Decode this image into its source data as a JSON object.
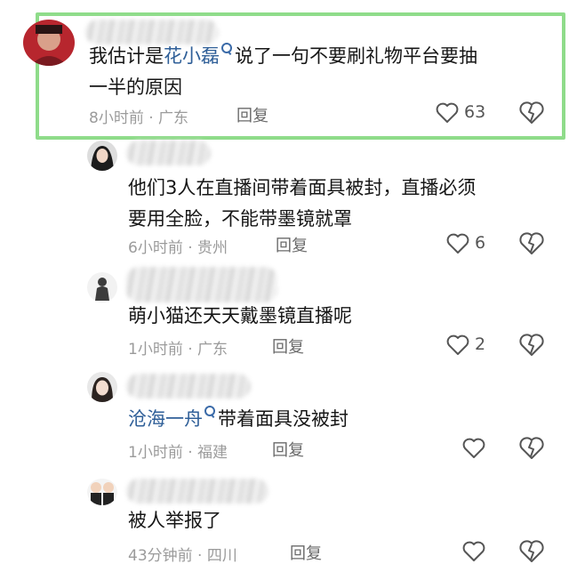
{
  "top_fragment": "••",
  "comments": [
    {
      "avatar": "red-avatar",
      "text_before": "我估计是",
      "mention": "花小磊",
      "text_after": "说了一句不要刷礼物平台要抽",
      "text_line2": "一半的原因",
      "time": "8小时前",
      "location": "广东",
      "reply_label": "回复",
      "like_count": "63",
      "highlighted": true
    },
    {
      "avatar": "woman-avatar",
      "text_line1": "他们3人在直播间带着面具被封，直播必须",
      "text_line2": "要用全脸，不能带墨镜就罩",
      "time": "6小时前",
      "location": "贵州",
      "reply_label": "回复",
      "like_count": "6"
    },
    {
      "avatar": "figure-avatar",
      "text_line1": "萌小猫还天天戴墨镜直播呢",
      "time": "1小时前",
      "location": "广东",
      "reply_label": "回复",
      "like_count": "2"
    },
    {
      "avatar": "girl-avatar",
      "mention": "沧海一舟",
      "text_after": "带着面具没被封",
      "time": "1小时前",
      "location": "福建",
      "reply_label": "回复",
      "like_count": ""
    },
    {
      "avatar": "babies-avatar",
      "text_line1": "被人举报了",
      "time": "43分钟前",
      "location": "四川",
      "reply_label": "回复",
      "like_count": ""
    }
  ],
  "meta_separator": " · ",
  "colors": {
    "highlight_border": "#8fdc8a",
    "mention": "#2f5f98",
    "meta": "#9b9b9b"
  }
}
